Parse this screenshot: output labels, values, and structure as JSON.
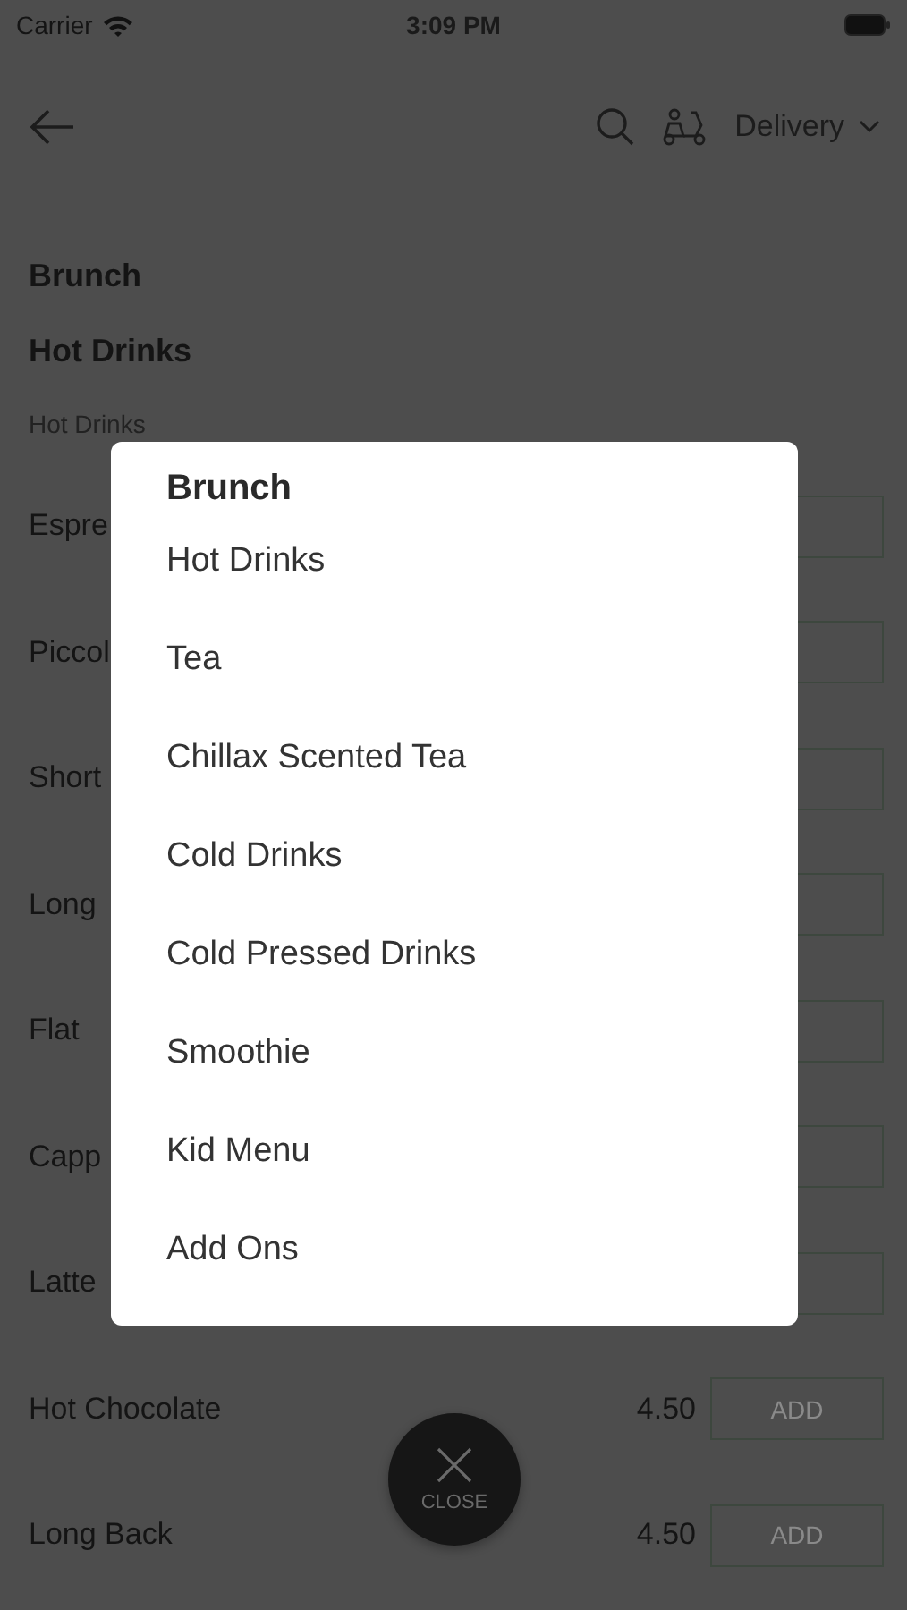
{
  "status_bar": {
    "carrier": "Carrier",
    "time": "3:09 PM"
  },
  "header": {
    "order_mode": "Delivery"
  },
  "breadcrumb": [
    "Brunch",
    "Hot Drinks"
  ],
  "section_title": "Hot Drinks",
  "items": [
    {
      "kind": "partial",
      "name": "Espre"
    },
    {
      "kind": "partial",
      "name": "Piccol"
    },
    {
      "kind": "partial",
      "name": "Short"
    },
    {
      "kind": "partial",
      "name": "Long"
    },
    {
      "kind": "partial",
      "name": "Flat"
    },
    {
      "kind": "partial",
      "name": "Capp"
    },
    {
      "kind": "partial",
      "name": "Latte"
    },
    {
      "kind": "full",
      "name": "Hot Chocolate",
      "price": "4.50",
      "button": "ADD"
    },
    {
      "kind": "full",
      "name": "Long Back",
      "price": "4.50",
      "button": "ADD"
    }
  ],
  "category_menu": {
    "title": "Brunch",
    "items": [
      "Hot Drinks",
      "Tea",
      "Chillax Scented Tea",
      "Cold Drinks",
      "Cold Pressed Drinks",
      "Smoothie",
      "Kid Menu",
      "Add Ons"
    ]
  },
  "close_button": {
    "label": "CLOSE"
  }
}
